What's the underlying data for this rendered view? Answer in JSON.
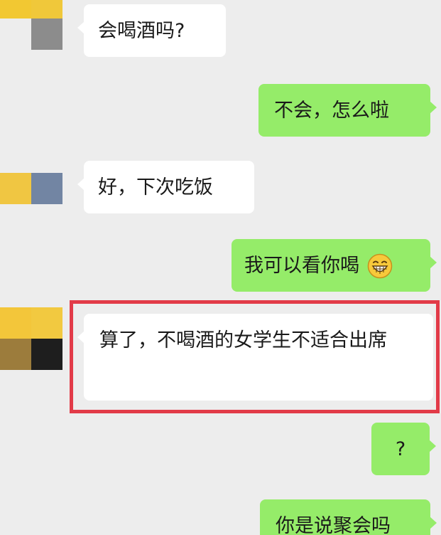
{
  "colors": {
    "background": "#ededed",
    "incoming_bubble": "#ffffff",
    "outgoing_bubble": "#95ec69",
    "highlight_border": "#e23b48"
  },
  "messages": [
    {
      "side": "incoming",
      "text": "会喝酒吗?"
    },
    {
      "side": "outgoing",
      "text": "不会，怎么啦"
    },
    {
      "side": "incoming",
      "text": "好，下次吃饭"
    },
    {
      "side": "outgoing",
      "text": "我可以看你喝",
      "emoji": "grinning-face-emoji"
    },
    {
      "side": "incoming",
      "text": "算了，不喝酒的女学生不适合出席",
      "highlighted": true
    },
    {
      "side": "outgoing",
      "text": "?"
    },
    {
      "side": "outgoing",
      "text": "你是说聚会吗"
    }
  ]
}
